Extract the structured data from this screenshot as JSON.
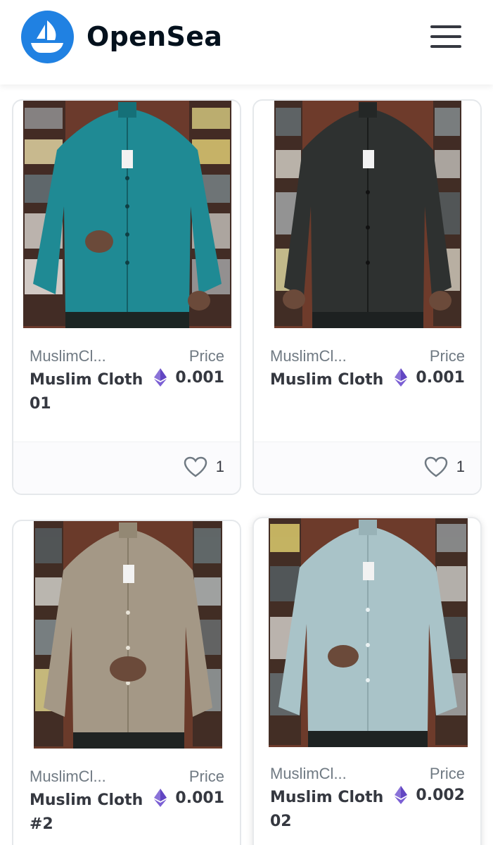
{
  "header": {
    "brand": "OpenSea",
    "logo_icon": "opensea-boat-icon",
    "menu_icon": "hamburger-menu-icon",
    "accent_color": "#2081e2"
  },
  "cards": [
    {
      "collection": "MuslimCl...",
      "name": "Muslim Cloth 01",
      "price_label": "Price",
      "price": "0.001",
      "currency_icon": "ethereum-icon",
      "likes": "1",
      "shirt_color": "#1f8a94"
    },
    {
      "collection": "MuslimCl...",
      "name": "Muslim Cloth",
      "price_label": "Price",
      "price": "0.001",
      "currency_icon": "ethereum-icon",
      "likes": "1",
      "shirt_color": "#2e3130"
    },
    {
      "collection": "MuslimCl...",
      "name": "Muslim Cloth #2",
      "price_label": "Price",
      "price": "0.001",
      "currency_icon": "ethereum-icon",
      "shirt_color": "#a49886"
    },
    {
      "collection": "MuslimCl...",
      "name": "Muslim Cloth 02",
      "price_label": "Price",
      "price": "0.002",
      "currency_icon": "ethereum-icon",
      "shirt_color": "#a9c3c8"
    }
  ]
}
